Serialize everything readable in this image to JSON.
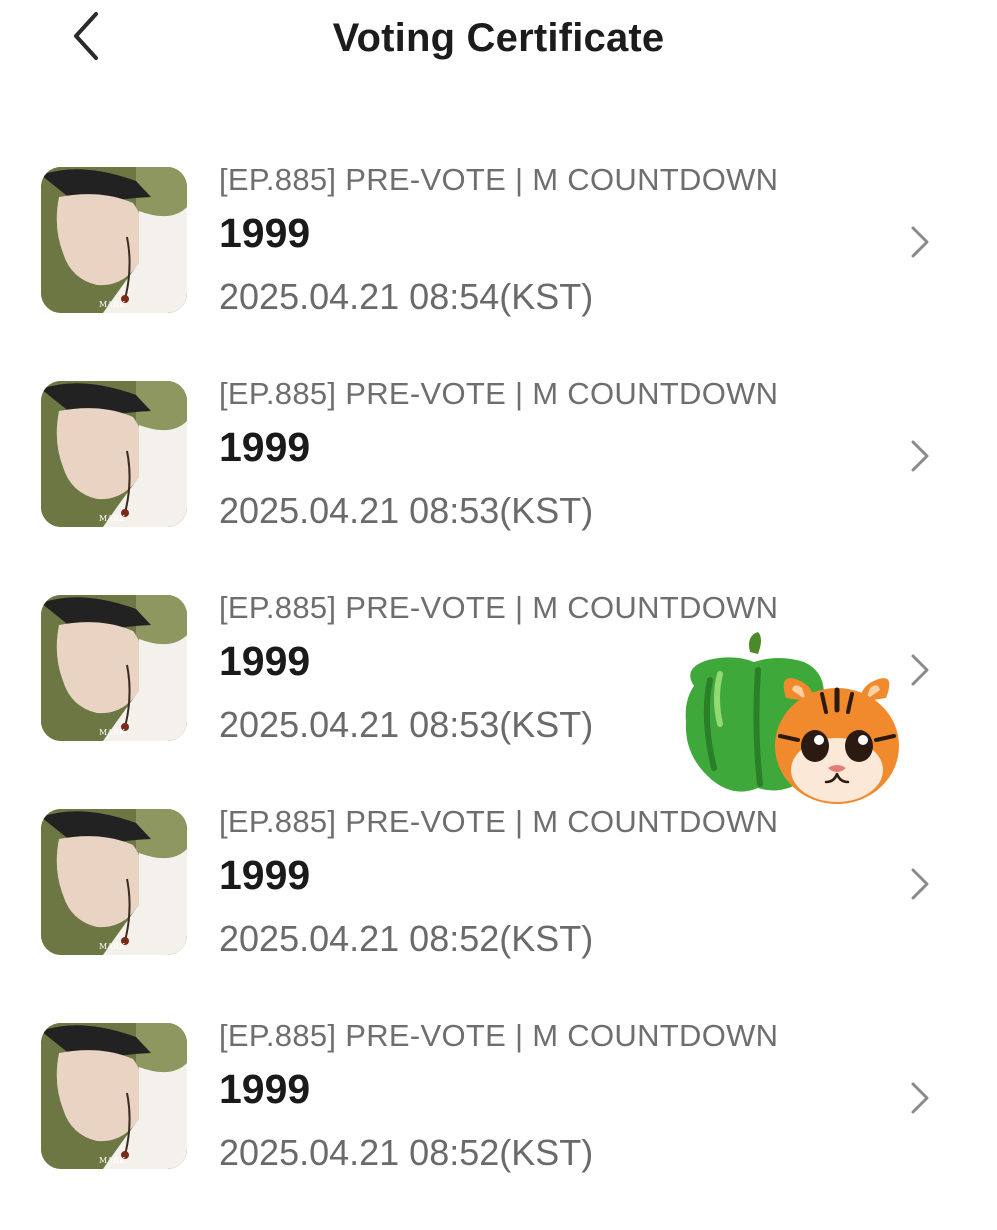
{
  "header": {
    "title": "Voting Certificate",
    "back_icon": "chevron-left-icon"
  },
  "certificates": [
    {
      "episode": "[EP.885] PRE-VOTE | M COUNTDOWN",
      "song": "1999",
      "timestamp": "2025.04.21 08:54(KST)",
      "thumb_text": "MARK"
    },
    {
      "episode": "[EP.885] PRE-VOTE | M COUNTDOWN",
      "song": "1999",
      "timestamp": "2025.04.21 08:53(KST)",
      "thumb_text": "MARK"
    },
    {
      "episode": "[EP.885] PRE-VOTE | M COUNTDOWN",
      "song": "1999",
      "timestamp": "2025.04.21 08:53(KST)",
      "thumb_text": "MARK"
    },
    {
      "episode": "[EP.885] PRE-VOTE | M COUNTDOWN",
      "song": "1999",
      "timestamp": "2025.04.21 08:52(KST)",
      "thumb_text": "MARK"
    },
    {
      "episode": "[EP.885] PRE-VOTE | M COUNTDOWN",
      "song": "1999",
      "timestamp": "2025.04.21 08:52(KST)",
      "thumb_text": "MARK"
    }
  ],
  "row_chevron_icon": "chevron-right-icon",
  "stickers": [
    "bell-pepper-icon",
    "tiger-face-icon"
  ],
  "colors": {
    "title": "#1c1c1c",
    "episode": "#6e6e6e",
    "timestamp": "#6a6a6a",
    "chevron": "#8a8a8a",
    "pepper": "#3fa83a",
    "tiger": "#f08a2c"
  }
}
